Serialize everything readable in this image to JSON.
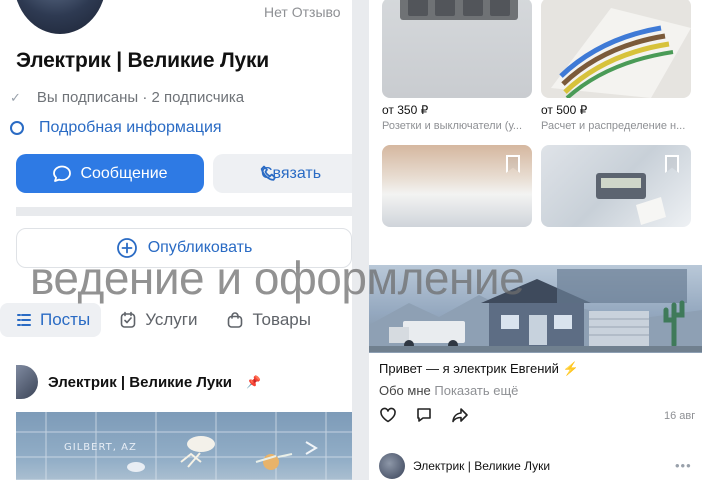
{
  "profile": {
    "reviews_label": "Нет Отзыво",
    "name": "Электрик | Великие Луки",
    "subscribed": "Вы подписаны · 2 подписчика",
    "details_link": "Подробная информация",
    "message_button": "Сообщение",
    "call_button": "Связать",
    "publish_button": "Опубликовать"
  },
  "overlay_text": "ведение и оформление",
  "tabs": [
    {
      "label": "Посты",
      "icon": "list-icon",
      "active": true
    },
    {
      "label": "Услуги",
      "icon": "checklist-icon",
      "active": false
    },
    {
      "label": "Товары",
      "icon": "bag-icon",
      "active": false
    }
  ],
  "left_post": {
    "author": "Электрик | Великие Луки",
    "pin_icon": "pin-icon",
    "image_text": "GILBERT, AZ"
  },
  "products": [
    {
      "price": "от 350 ₽",
      "category": "Розетки и выключатели (у..."
    },
    {
      "price": "от 500 ₽",
      "category": "Расчет и распределение н..."
    },
    {
      "price": "",
      "category": ""
    },
    {
      "price": "",
      "category": ""
    }
  ],
  "right_post": {
    "text": "Привет — я электрик Евгений ⚡",
    "about_label": "Обо мне",
    "show_more": "Показать ещё",
    "date": "16 авг",
    "next_author": "Электрик | Великие Луки",
    "more_icon": "more-dots-icon"
  },
  "colors": {
    "accent": "#2e7ae4",
    "link": "#2a6bc4",
    "muted": "#8e9094"
  }
}
